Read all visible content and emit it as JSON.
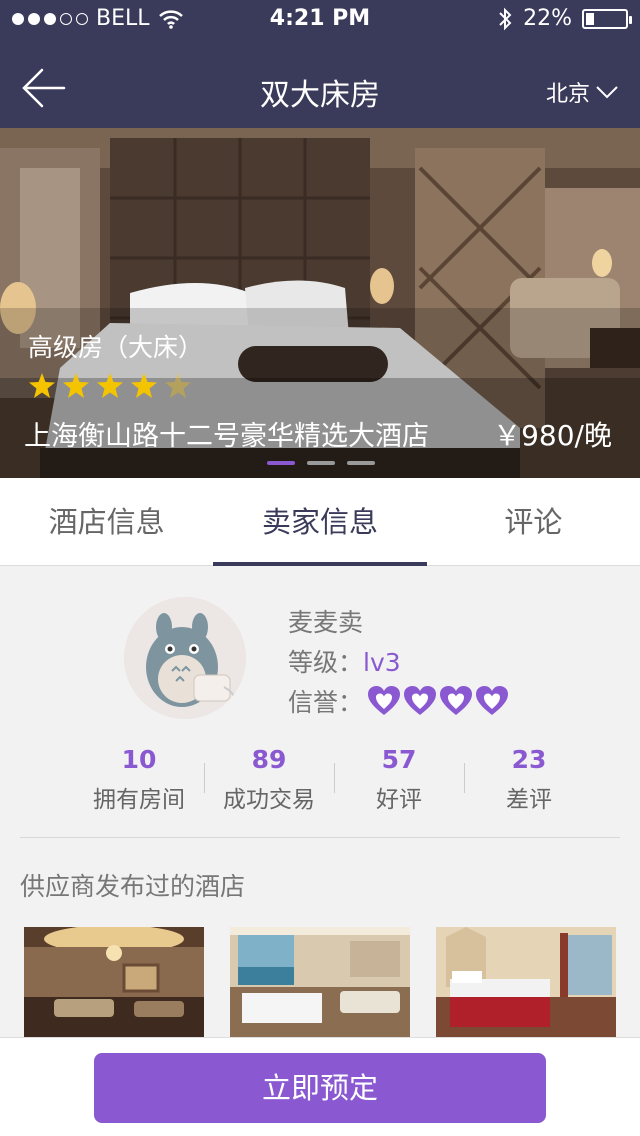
{
  "status_bar": {
    "carrier": "BELL",
    "time": "4:21 PM",
    "battery": "22%",
    "battery_level": 0.22
  },
  "nav": {
    "title": "双大床房",
    "city": "北京"
  },
  "hero": {
    "room_type": "高级房（大床）",
    "rating": 4,
    "rating_max": 5,
    "hotel_name": "上海衡山路十二号豪华精选大酒店",
    "price": "￥980/晚",
    "pages": 3,
    "active_page": 1
  },
  "tabs": [
    {
      "label": "酒店信息"
    },
    {
      "label": "卖家信息"
    },
    {
      "label": "评论"
    }
  ],
  "seller": {
    "name": "麦麦卖",
    "level_label": "等级：",
    "level_value": "lv3",
    "credit_label": "信誉：",
    "credit_hearts": 4,
    "stats": [
      {
        "value": "10",
        "label": "拥有房间"
      },
      {
        "value": "89",
        "label": "成功交易"
      },
      {
        "value": "57",
        "label": "好评"
      },
      {
        "value": "23",
        "label": "差评"
      }
    ],
    "section_title": "供应商发布过的酒店"
  },
  "bottom": {
    "book_label": "立即预定"
  },
  "colors": {
    "header": "#3a3a5a",
    "accent": "#8a59d1",
    "star": "#f5c400"
  }
}
